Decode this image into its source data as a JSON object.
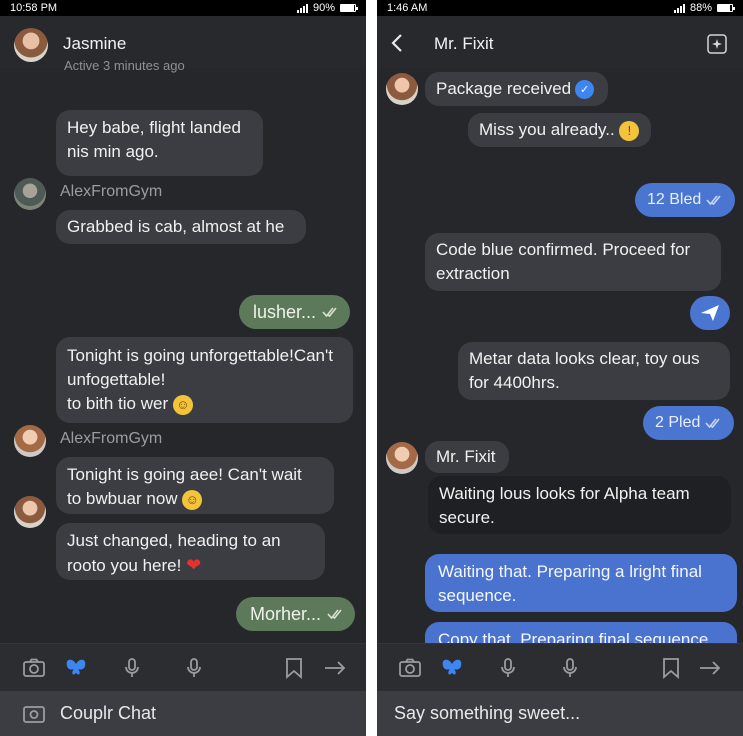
{
  "left": {
    "status": {
      "time": "10:58 PM",
      "battery": "90%",
      "battery_level": 0.9
    },
    "header": {
      "name": "Jasmine",
      "status": "Active 3 minutes ago"
    },
    "messages": {
      "m1_line1": "Hey babe, flight landed",
      "m1_line2": "nis min ago.",
      "sender1": "AlexFromGym",
      "m2": "Grabbed is cab, almost at he",
      "sent1": "lusher...",
      "m3_line1": "Tonight is going unforgettable!Can't",
      "m3_line2": "unfogettable!",
      "m3_line3": "to bith tio wer",
      "m3_emoji": "☺",
      "sender2": "AlexFromGym",
      "m4_line1": "Tonight is going aee! Can't wait",
      "m4_line2": "to bwbuar now",
      "m4_emoji": "☺",
      "m5_line1": "Just changed, heading to an",
      "m5_line2": "rooto you here!",
      "m5_heart": "❤",
      "sent2": "Morher..."
    },
    "compose": {
      "placeholder": "Couplr Chat"
    }
  },
  "right": {
    "status": {
      "time": "1:46 AM",
      "battery": "88%",
      "battery_level": 0.88
    },
    "header": {
      "title": "Mr. Fixit"
    },
    "messages": {
      "m1": "Package received",
      "m2": "Miss you already..",
      "m2_emoji": "!",
      "sent1": "12 Bled",
      "m3_line1": "Code blue confirmed. Proceed for",
      "m3_line2": "extraction",
      "m4_line1": "Metar data looks clear, toy ous",
      "m4_line2": "for 4400hrs.",
      "sent2": "2 Pled",
      "sender": "Mr. Fixit",
      "m5_line1": "Waiting lous looks for Alpha team",
      "m5_line2": "secure.",
      "m6_line1": "Waiting that. Preparing a lright final",
      "m6_line2": "sequence.",
      "m7": "Copy that. Preparing final sequence"
    },
    "compose": {
      "placeholder": "Say something sweet..."
    }
  },
  "colors": {
    "background": "#25272b",
    "bubble_received": "#3b3d42",
    "bubble_sent_green": "#5c7a59",
    "bubble_sent_blue": "#4a76d1",
    "accent_blue": "#3d86f2"
  },
  "icons": [
    "camera-icon",
    "butterfly-icon",
    "mic-icon",
    "bookmark-icon",
    "arrow-right-icon",
    "back-icon",
    "sparkle-icon",
    "send-icon",
    "double-check-icon",
    "verified-icon"
  ]
}
